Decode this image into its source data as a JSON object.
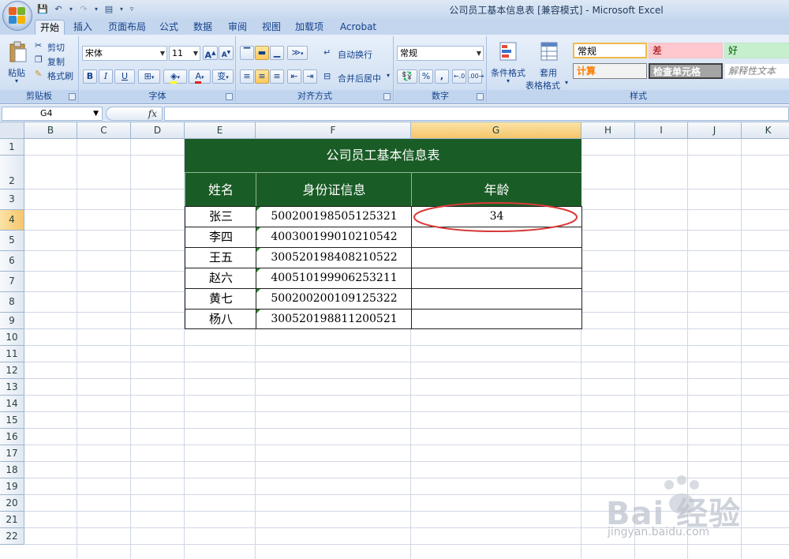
{
  "window": {
    "title": "公司员工基本信息表  [兼容模式] - Microsoft Excel"
  },
  "tabs": [
    "开始",
    "插入",
    "页面布局",
    "公式",
    "数据",
    "审阅",
    "视图",
    "加载项",
    "Acrobat"
  ],
  "active_tab": "开始",
  "ribbon": {
    "clipboard": {
      "paste": "粘贴",
      "cut": "剪切",
      "copy": "复制",
      "format_painter": "格式刷",
      "label": "剪贴板"
    },
    "font": {
      "name": "宋体",
      "size": "11",
      "bold": "B",
      "italic": "I",
      "underline": "U",
      "grow": "A",
      "shrink": "A",
      "font_color": "A",
      "phonetic": "变",
      "label": "字体"
    },
    "alignment": {
      "wrap": "自动换行",
      "merge": "合并后居中",
      "label": "对齐方式"
    },
    "number": {
      "format": "常规",
      "percent": "%",
      "comma": ",",
      "label": "数字"
    },
    "styles": {
      "conditional": "条件格式",
      "table_format_1": "套用",
      "table_format_2": "表格格式",
      "normal": "常规",
      "bad": "差",
      "good": "好",
      "calculation": "计算",
      "check_cell": "检查单元格",
      "explanatory": "解释性文本",
      "label": "样式"
    }
  },
  "formula_bar": {
    "name_box": "G4",
    "fx": "fx",
    "content": ""
  },
  "columns": [
    "B",
    "C",
    "D",
    "E",
    "F",
    "G",
    "H",
    "I",
    "J",
    "K"
  ],
  "selected_column": "G",
  "rows": [
    "1",
    "2",
    "3",
    "4",
    "5",
    "6",
    "7",
    "8",
    "9",
    "10",
    "11",
    "12",
    "13",
    "14",
    "15",
    "16",
    "17",
    "18",
    "19",
    "20",
    "21",
    "22"
  ],
  "selected_row": "4",
  "table": {
    "title": "公司员工基本信息表",
    "headers": [
      "姓名",
      "身份证信息",
      "年龄"
    ],
    "rows": [
      {
        "name": "张三",
        "id": "500200198505125321",
        "age": "34"
      },
      {
        "name": "李四",
        "id": "400300199010210542",
        "age": ""
      },
      {
        "name": "王五",
        "id": "300520198408210522",
        "age": ""
      },
      {
        "name": "赵六",
        "id": "400510199906253211",
        "age": ""
      },
      {
        "name": "黄七",
        "id": "500200200109125322",
        "age": ""
      },
      {
        "name": "杨八",
        "id": "300520198811200521",
        "age": ""
      }
    ],
    "colors": {
      "header_bg": "#1a5c26",
      "header_text": "#ffffff",
      "annotation": "#d93a3a"
    }
  },
  "watermark": {
    "brand": "Bai 经验",
    "url": "jingyan.baidu.com"
  }
}
